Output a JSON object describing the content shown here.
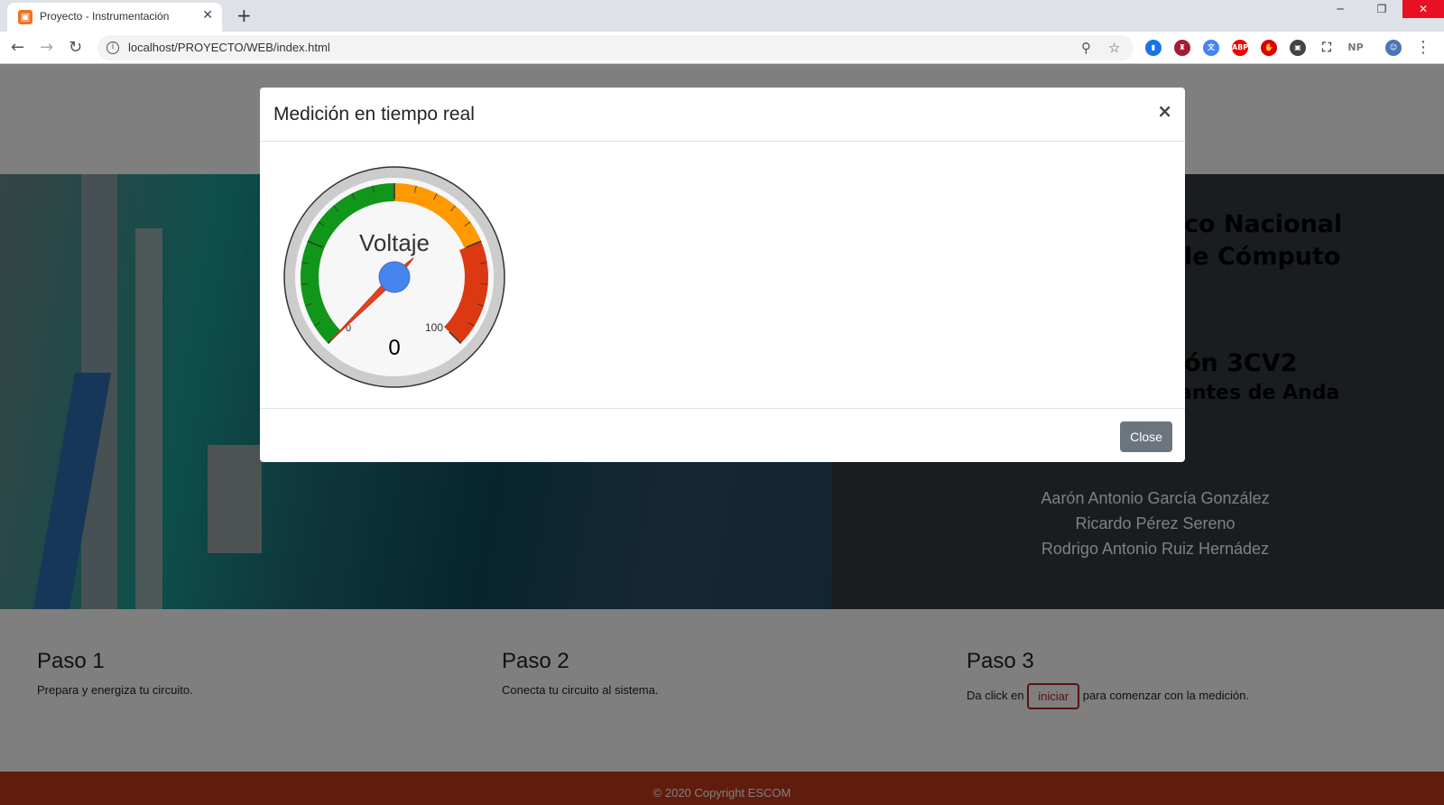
{
  "browser": {
    "tab_title": "Proyecto - Instrumentación",
    "url": "localhost/PROYECTO/WEB/index.html",
    "extension_np": "NP"
  },
  "hero": {
    "line1": "co Nacional",
    "line2": "le Cómputo",
    "line3": "ón 3CV2",
    "line4": "antes de Anda",
    "names": [
      "Aarón Antonio García González",
      "Ricardo Pérez Sereno",
      "Rodrigo Antonio Ruiz Hernádez"
    ]
  },
  "steps": [
    {
      "title": "Paso 1",
      "text": "Prepara y energiza tu circuito."
    },
    {
      "title": "Paso 2",
      "text": "Conecta tu circuito al sistema."
    },
    {
      "title": "Paso 3",
      "text_before": "Da click en",
      "button": "iniciar",
      "text_after": "para comenzar con la medición."
    }
  ],
  "footer": "© 2020 Copyright ESCOM",
  "modal": {
    "title": "Medición en tiempo real",
    "close_label": "Close",
    "gauge": {
      "label": "Voltaje",
      "value": 0,
      "min_label": "0",
      "max_label": "100",
      "min": 0,
      "max": 100,
      "band_colors": {
        "green": "#109618",
        "orange": "#ff9900",
        "red": "#dc3912"
      },
      "needle_color": "#e2431e",
      "hub_color": "#4684ee"
    }
  }
}
